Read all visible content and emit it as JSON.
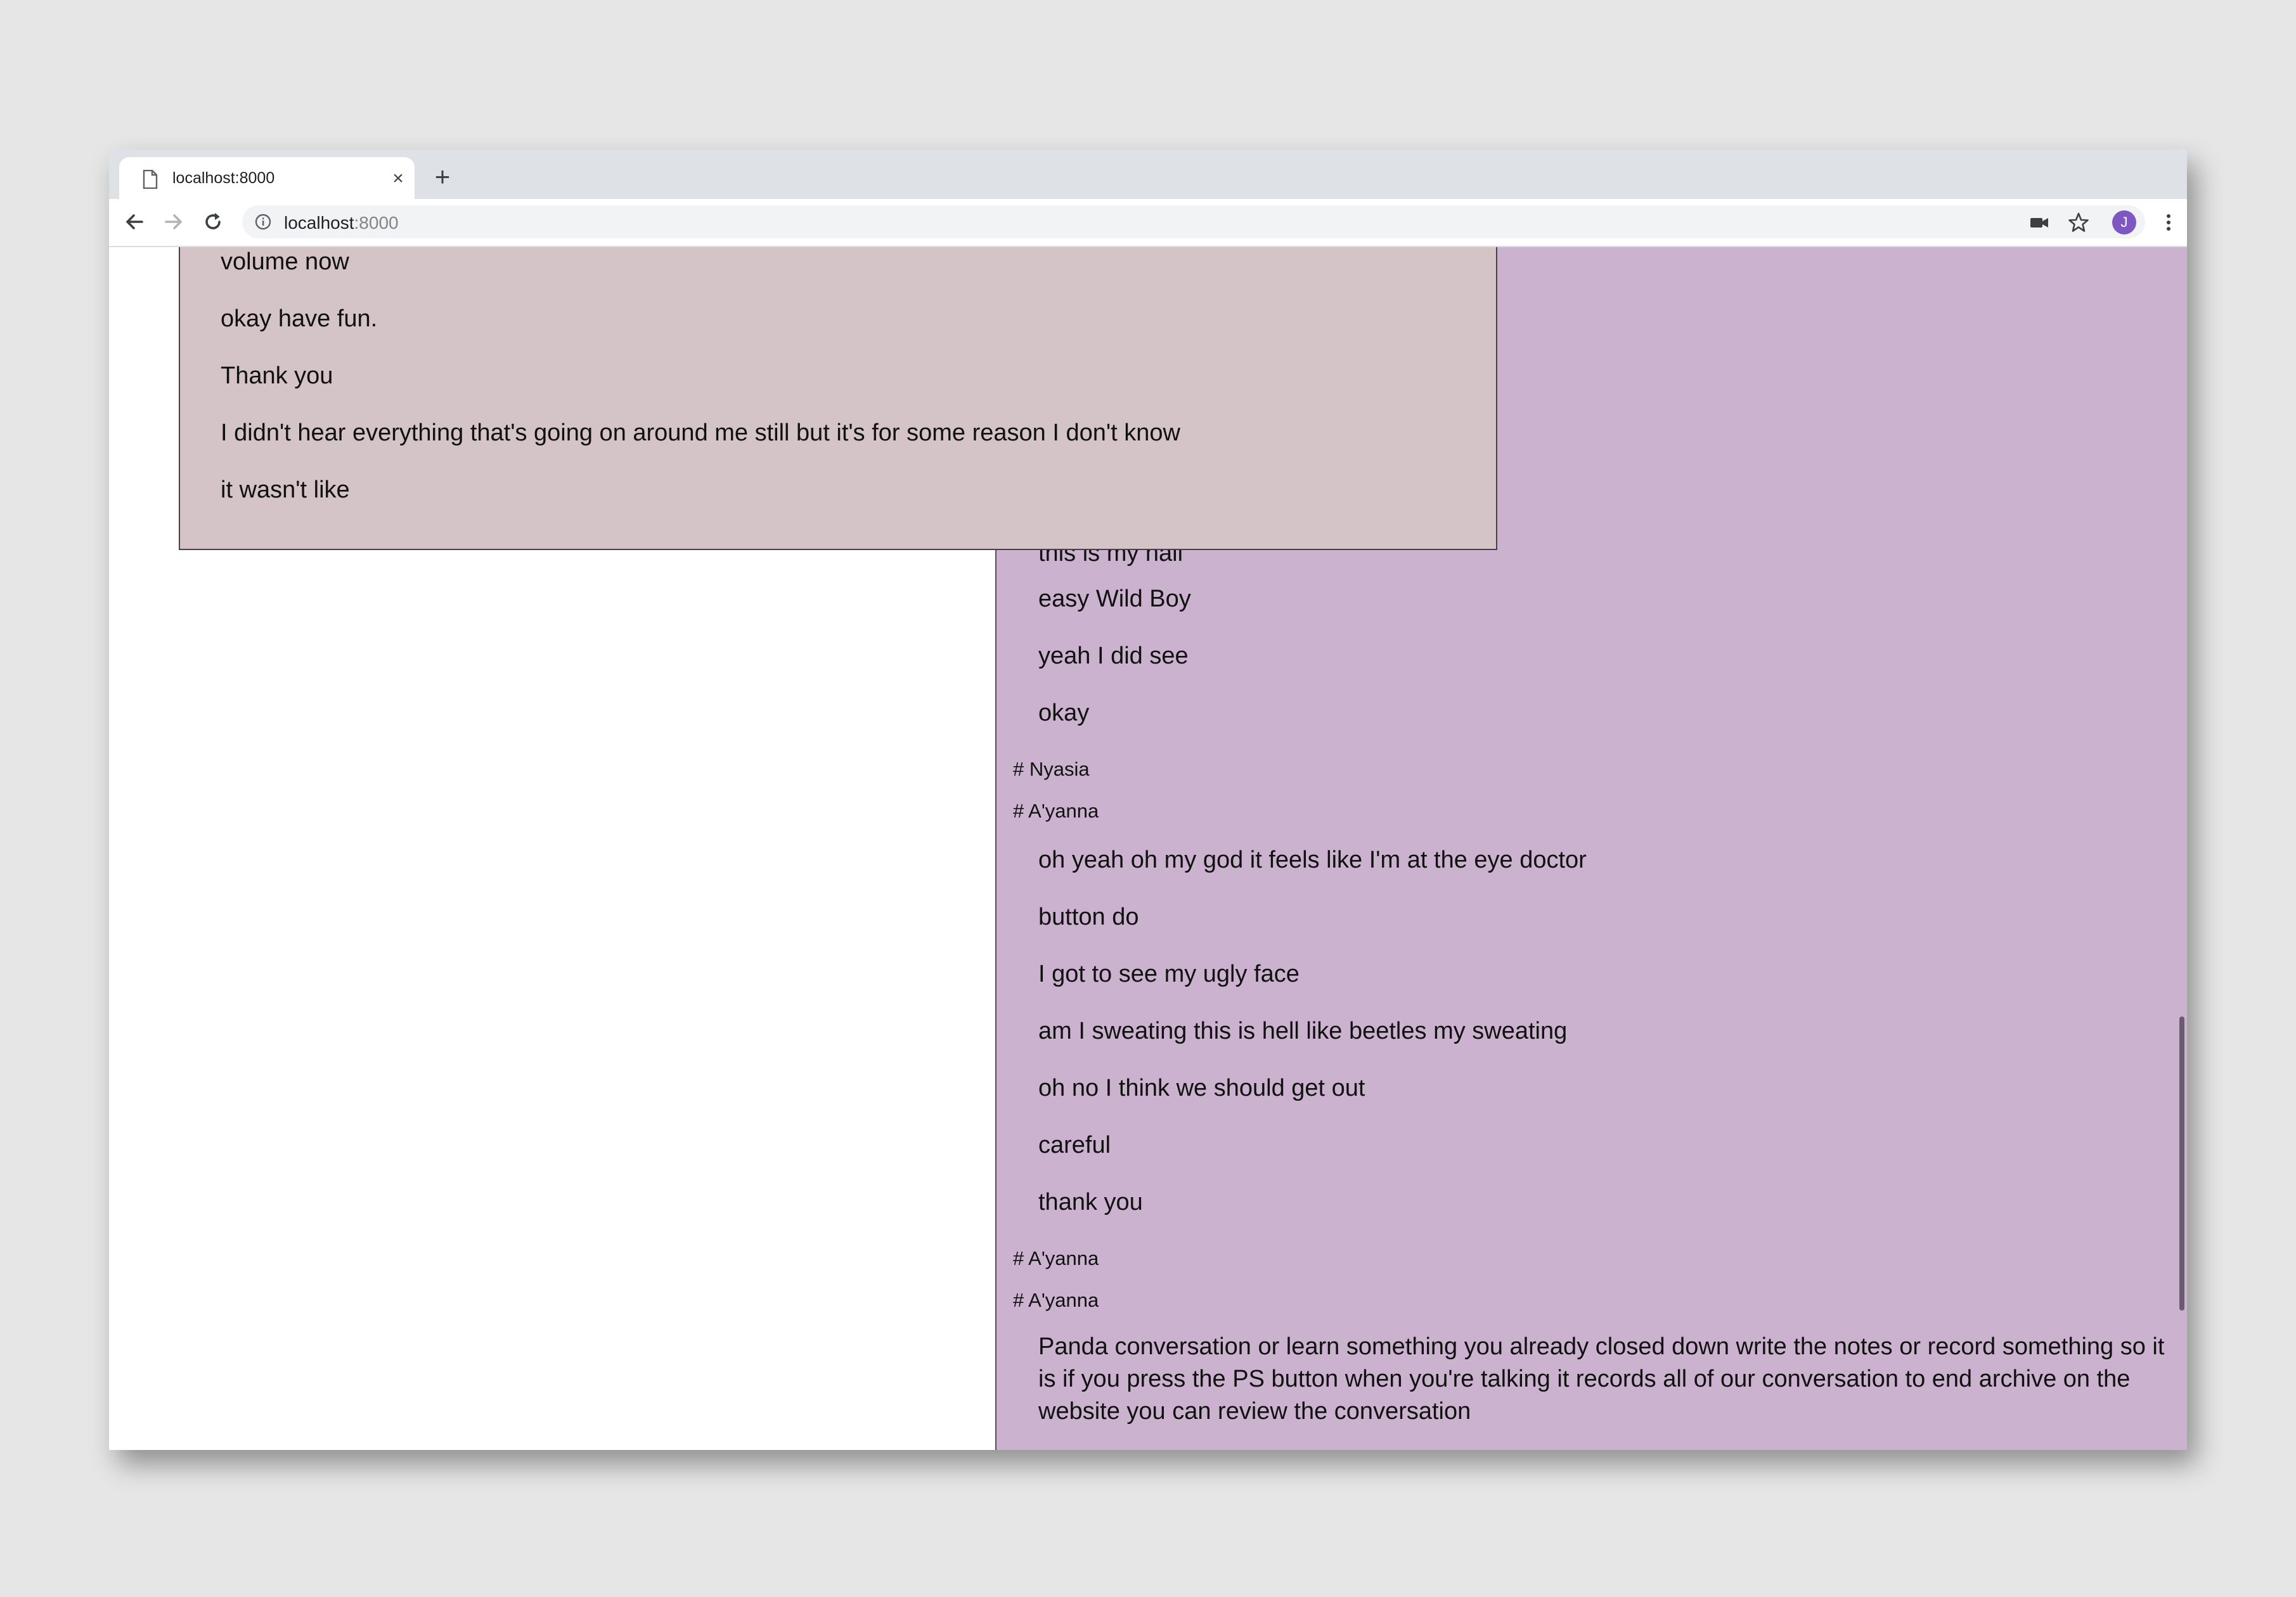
{
  "browser": {
    "tab": {
      "title": "localhost:8000",
      "close_glyph": "×"
    },
    "new_tab_glyph": "+",
    "url": {
      "host": "localhost",
      "port": ":8000"
    },
    "avatar_initial": "J"
  },
  "left_transcript": {
    "lines": [
      "volume now",
      "okay have fun.",
      "Thank you",
      "I didn't hear everything that's going on around me still but it's for some reason I don't know",
      "it wasn't like"
    ]
  },
  "right_transcript": {
    "partial_line": "this is my hall",
    "block1": [
      "easy Wild Boy",
      "yeah I did see",
      "okay"
    ],
    "speakers1": [
      "# Nyasia",
      "# A'yanna"
    ],
    "block2": [
      "oh yeah oh my god it feels like I'm at the eye doctor",
      "button do",
      "I got to see my ugly face",
      "am I sweating this is hell like beetles my sweating",
      "oh no I think we should get out",
      "careful",
      "thank you"
    ],
    "speakers2": [
      "# A'yanna",
      "# A'yanna"
    ],
    "paragraph": "Panda conversation or learn something you already closed down write the notes or record something so it is if you press the PS button when you're talking it records all of our conversation to end archive on the website you can review the conversation"
  },
  "colors": {
    "right_panel_bg": "#cbb2cf",
    "left_panel_bg": "#d4c4c7",
    "desktop_bg": "#e6e6e6",
    "avatar_bg": "#7e57c2"
  },
  "icons": [
    "page-icon",
    "close-icon",
    "plus-icon",
    "back-arrow-icon",
    "forward-arrow-icon",
    "reload-icon",
    "info-icon",
    "camera-icon",
    "star-icon",
    "kebab-menu-icon"
  ]
}
